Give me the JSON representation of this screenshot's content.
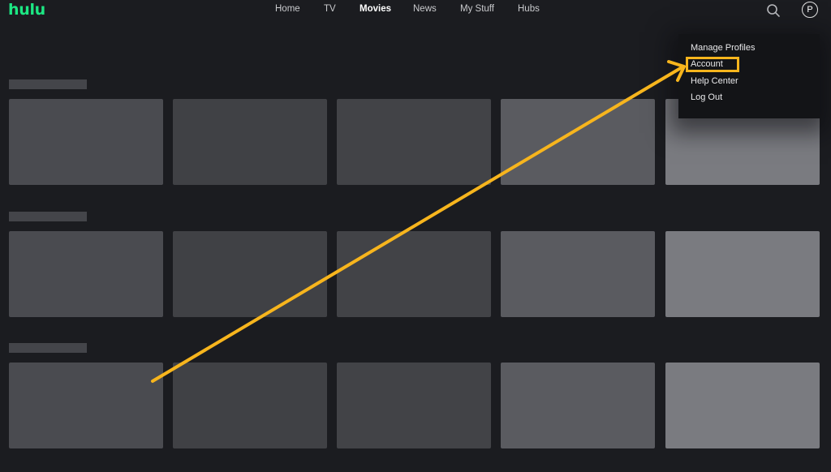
{
  "brand": {
    "logo_text": "hulu",
    "logo_color": "#1ce783"
  },
  "nav": {
    "items": [
      {
        "label": "Home"
      },
      {
        "label": "TV"
      },
      {
        "label": "Movies",
        "active": true
      },
      {
        "label": "News"
      },
      {
        "label": "My Stuff"
      },
      {
        "label": "Hubs"
      }
    ]
  },
  "header": {
    "search_icon": "search-icon",
    "avatar_initial": "P"
  },
  "profile_menu": {
    "items": [
      {
        "label": "Manage Profiles"
      },
      {
        "label": "Account",
        "highlighted": true
      },
      {
        "label": "Help Center"
      },
      {
        "label": "Log Out"
      }
    ]
  },
  "colors": {
    "background": "#1b1c20",
    "annotation": "#f7b51d",
    "tile_shades": [
      "#4a4b50",
      "#404145",
      "#424347",
      "#5a5b60",
      "#7a7b80"
    ]
  }
}
